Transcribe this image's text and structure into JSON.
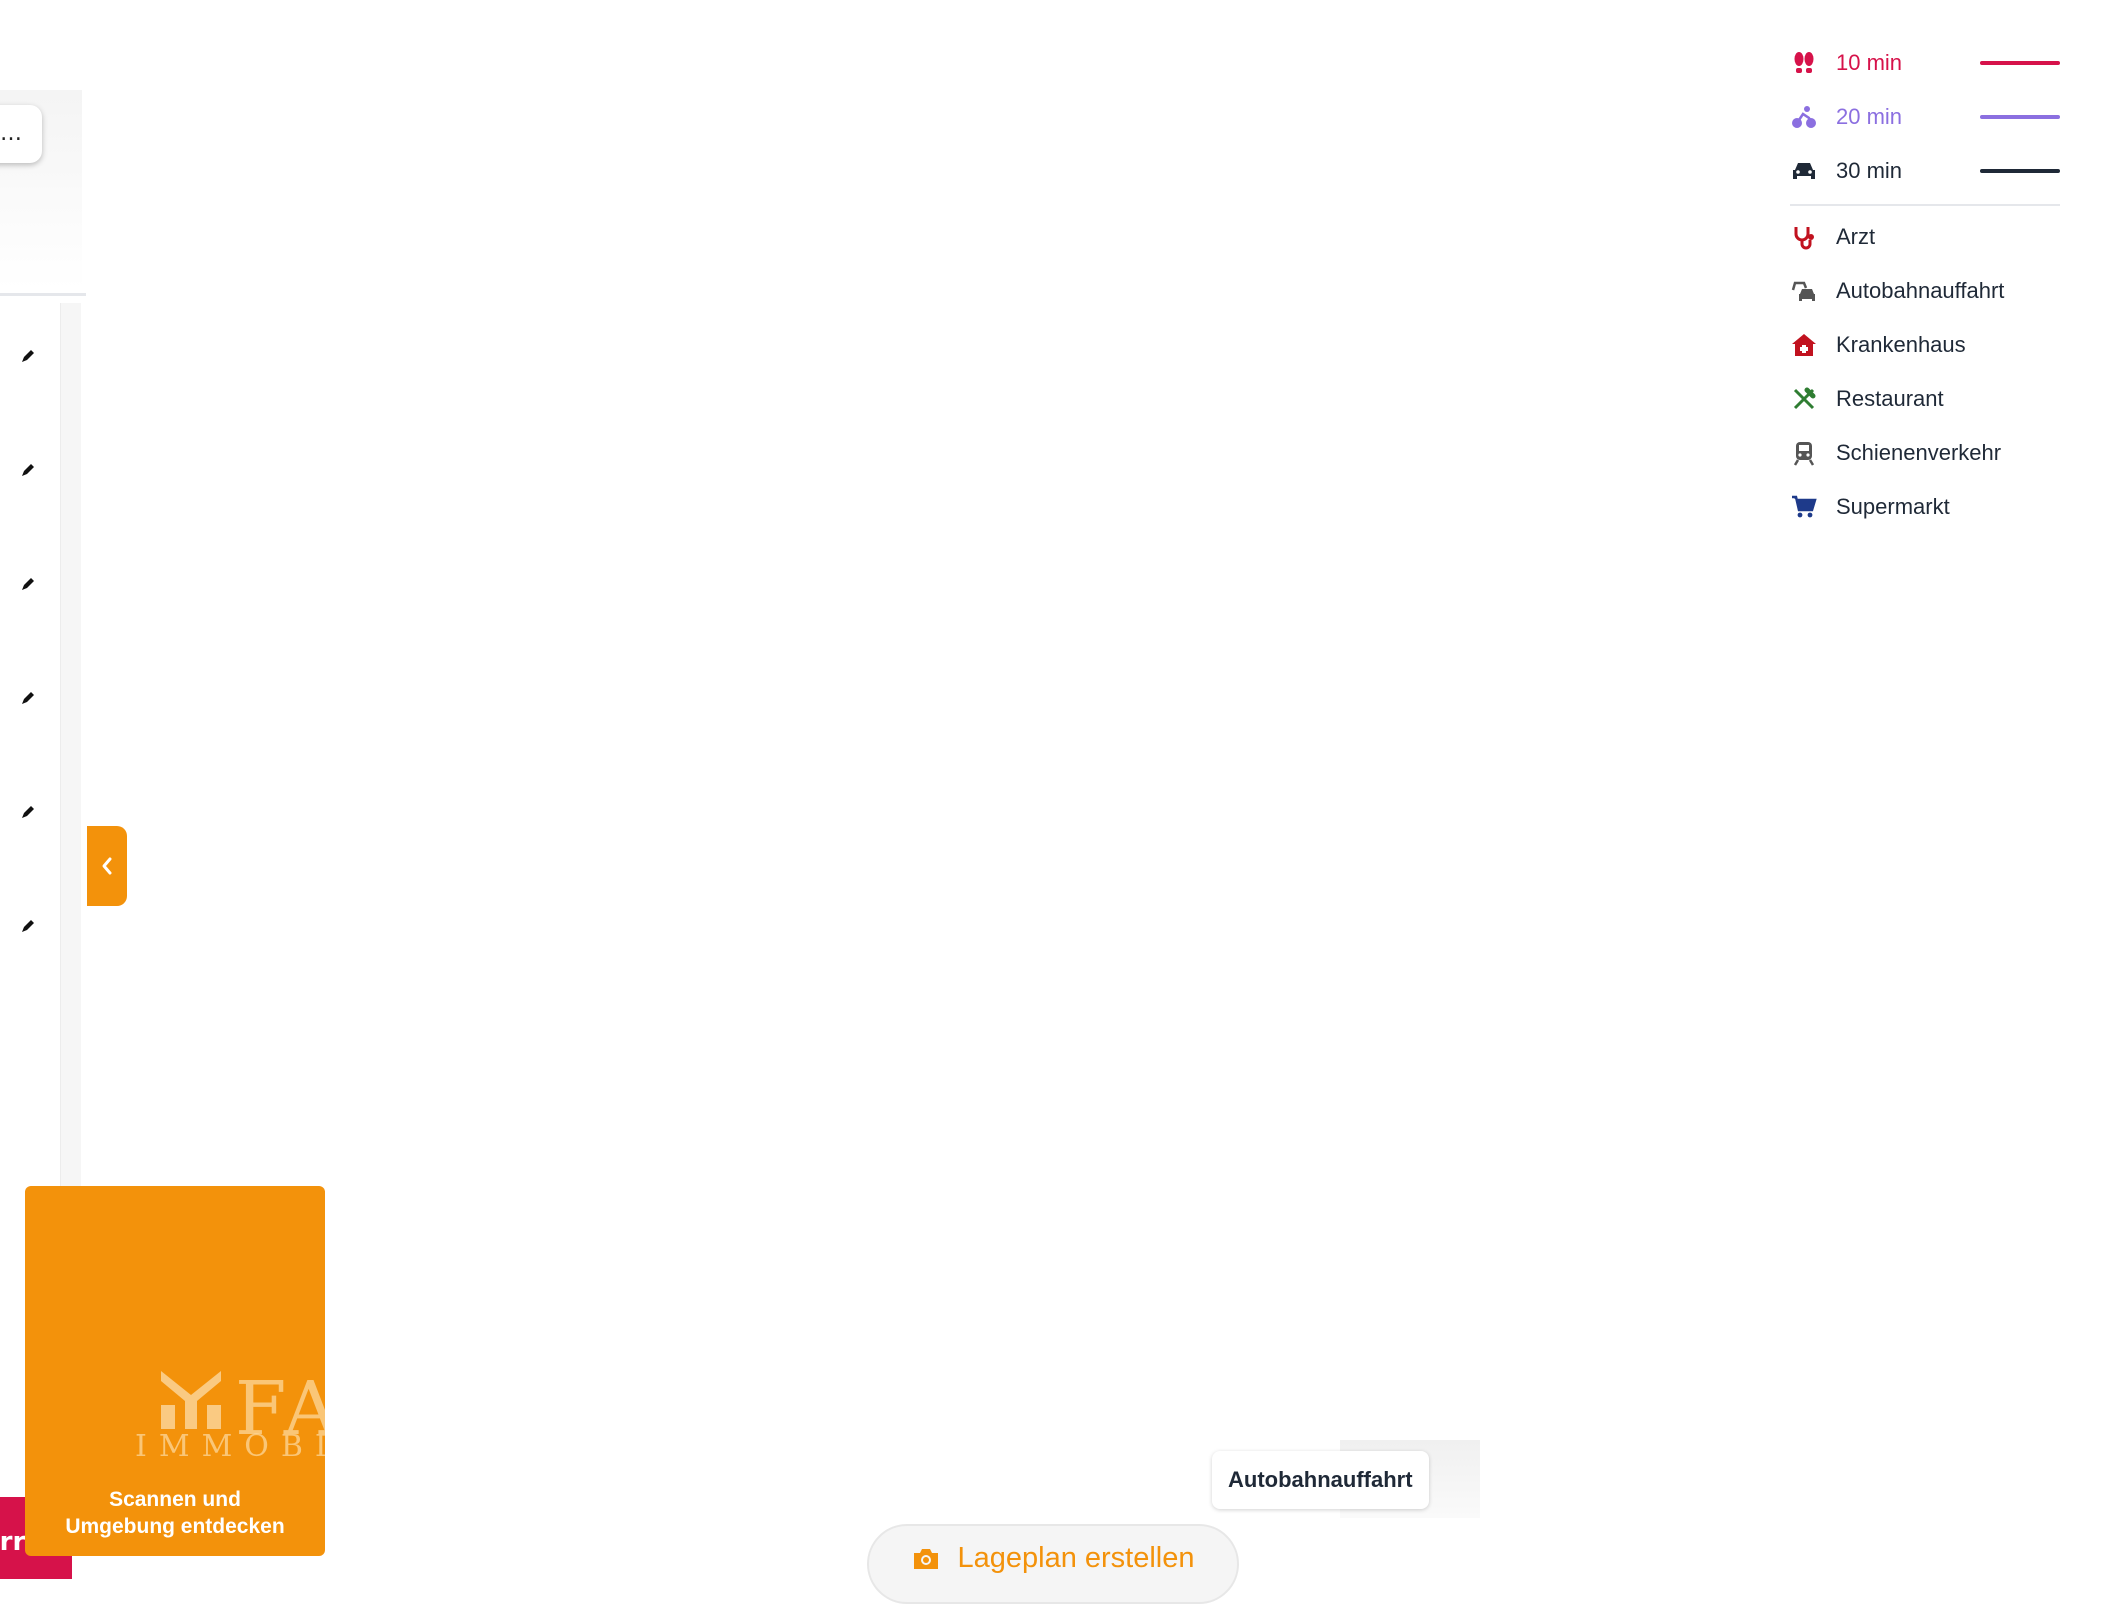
{
  "sidebar": {
    "search_value": "…",
    "edit_icon_count": 6,
    "bottom_button_fragment": "err"
  },
  "legend": {
    "travel": [
      {
        "label": "10 min",
        "mode_icon": "walking-feet-icon",
        "color": "#d6124a"
      },
      {
        "label": "20 min",
        "mode_icon": "bicycle-icon",
        "color": "#8b6fe0"
      },
      {
        "label": "30 min",
        "mode_icon": "car-icon",
        "color": "#1f2937"
      }
    ],
    "poi": [
      {
        "label": "Arzt",
        "icon": "stethoscope-icon",
        "color": "#c1121f"
      },
      {
        "label": "Autobahnauffahrt",
        "icon": "highway-cars-icon",
        "color": "#555555"
      },
      {
        "label": "Krankenhaus",
        "icon": "hospital-house-icon",
        "color": "#c1121f"
      },
      {
        "label": "Restaurant",
        "icon": "fork-knife-icon",
        "color": "#2f7d32"
      },
      {
        "label": "Schienenverkehr",
        "icon": "train-icon",
        "color": "#555555"
      },
      {
        "label": "Supermarkt",
        "icon": "shopping-cart-icon",
        "color": "#1e3a8a"
      }
    ]
  },
  "scan_card": {
    "brand_word": "FA",
    "brand_sub": "IMMOBI",
    "text_line1": "Scannen und",
    "text_line2": "Umgebung entdecken"
  },
  "map": {
    "label": "Autobahnauffahrt"
  },
  "actions": {
    "lageplan_label": "Lageplan erstellen"
  },
  "colors": {
    "accent": "#f3920b",
    "walk": "#d6124a",
    "bike": "#8b6fe0",
    "car": "#1f2937"
  }
}
